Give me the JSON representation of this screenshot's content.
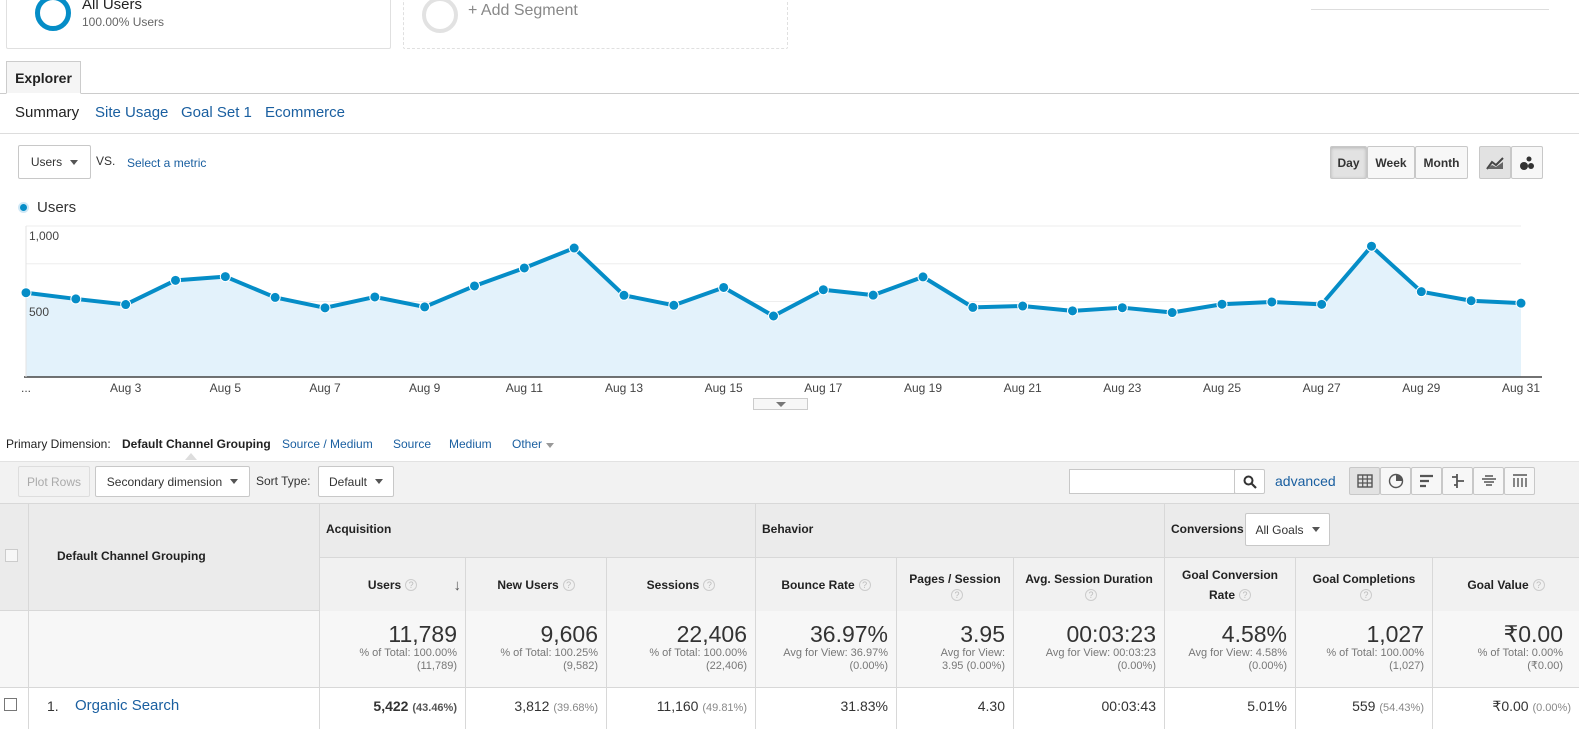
{
  "segments": {
    "active": {
      "name": "All Users",
      "sub": "100.00% Users"
    },
    "add_label": "+ Add Segment"
  },
  "tabs": {
    "explorer": "Explorer"
  },
  "subtabs": {
    "summary": "Summary",
    "site_usage": "Site Usage",
    "goal_set": "Goal Set 1",
    "ecommerce": "Ecommerce"
  },
  "chart_controls": {
    "metric": "Users",
    "vs": "VS.",
    "select_metric": "Select a metric",
    "day": "Day",
    "week": "Week",
    "month": "Month"
  },
  "legend": {
    "series_label": "Users",
    "color": "#058dc7"
  },
  "primary_dimension": {
    "label": "Primary Dimension:",
    "active": "Default Channel Grouping",
    "options": [
      "Source / Medium",
      "Source",
      "Medium",
      "Other"
    ]
  },
  "toolbar": {
    "plot_rows": "Plot Rows",
    "secondary_dimension": "Secondary dimension",
    "sort_type_label": "Sort Type:",
    "sort_type_value": "Default",
    "advanced": "advanced"
  },
  "table": {
    "dimension_header": "Default Channel Grouping",
    "groups": {
      "acquisition": "Acquisition",
      "behavior": "Behavior",
      "conversions": "Conversions",
      "goals_select": "All Goals"
    },
    "headers": {
      "users": "Users",
      "new_users": "New Users",
      "sessions": "Sessions",
      "bounce_rate": "Bounce Rate",
      "pages_session": "Pages / Session",
      "avg_duration": "Avg. Session Duration",
      "goal_conv_rate_1": "Goal Conversion",
      "goal_conv_rate_2": "Rate",
      "goal_completions": "Goal Completions",
      "goal_value": "Goal Value"
    },
    "totals": {
      "users": {
        "value": "11,789",
        "l1": "% of Total: 100.00%",
        "l2": "(11,789)"
      },
      "new_users": {
        "value": "9,606",
        "l1": "% of Total: 100.25%",
        "l2": "(9,582)"
      },
      "sessions": {
        "value": "22,406",
        "l1": "% of Total: 100.00%",
        "l2": "(22,406)"
      },
      "bounce_rate": {
        "value": "36.97%",
        "l1": "Avg for View: 36.97%",
        "l2": "(0.00%)"
      },
      "pages_session": {
        "value": "3.95",
        "l1": "Avg for View:",
        "l2": "3.95 (0.00%)"
      },
      "avg_duration": {
        "value": "00:03:23",
        "l1": "Avg for View: 00:03:23",
        "l2": "(0.00%)"
      },
      "goal_conv_rate": {
        "value": "4.58%",
        "l1": "Avg for View: 4.58%",
        "l2": "(0.00%)"
      },
      "goal_completions": {
        "value": "1,027",
        "l1": "% of Total: 100.00%",
        "l2": "(1,027)"
      },
      "goal_value": {
        "value": "₹0.00",
        "l1": "% of Total: 0.00%",
        "l2": "(₹0.00)"
      }
    },
    "rows": [
      {
        "index": "1.",
        "name": "Organic Search",
        "users": "5,422",
        "users_pct": "(43.46%)",
        "new_users": "3,812",
        "new_users_pct": "(39.68%)",
        "sessions": "11,160",
        "sessions_pct": "(49.81%)",
        "bounce_rate": "31.83%",
        "pages_session": "4.30",
        "avg_duration": "00:03:43",
        "goal_conv_rate": "5.01%",
        "goal_completions": "559",
        "goal_completions_pct": "(54.43%)",
        "goal_value": "₹0.00",
        "goal_value_pct": "(0.00%)"
      }
    ]
  },
  "chart_data": {
    "type": "area",
    "series": [
      {
        "name": "Users",
        "color": "#058dc7",
        "values": [
          558,
          517,
          480,
          640,
          665,
          527,
          458,
          530,
          464,
          603,
          722,
          854,
          541,
          475,
          593,
          404,
          578,
          542,
          663,
          461,
          470,
          438,
          459,
          427,
          482,
          497,
          481,
          866,
          565,
          505,
          489
        ]
      }
    ],
    "x": [
      1,
      2,
      3,
      4,
      5,
      6,
      7,
      8,
      9,
      10,
      11,
      12,
      13,
      14,
      15,
      16,
      17,
      18,
      19,
      20,
      21,
      22,
      23,
      24,
      25,
      26,
      27,
      28,
      29,
      30,
      31
    ],
    "x_tick_labels": [
      "...",
      "Aug 3",
      "Aug 5",
      "Aug 7",
      "Aug 9",
      "Aug 11",
      "Aug 13",
      "Aug 15",
      "Aug 17",
      "Aug 19",
      "Aug 21",
      "Aug 23",
      "Aug 25",
      "Aug 27",
      "Aug 29",
      "Aug 31"
    ],
    "y_tick_labels": [
      "1,000",
      "500"
    ],
    "ylim": [
      0,
      1000
    ],
    "grid": true,
    "fill_color": "#e3f2fb"
  }
}
